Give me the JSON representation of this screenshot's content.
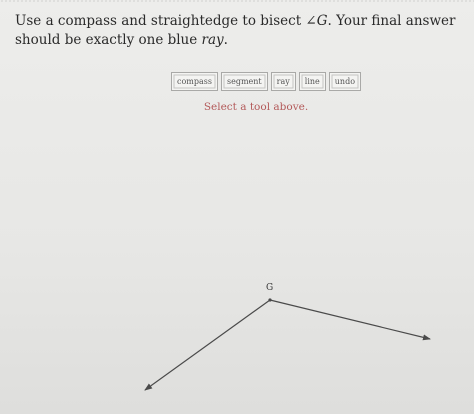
{
  "prompt": {
    "text_before": "Use a compass and straightedge to bisect ",
    "angle_symbol": "∠",
    "angle_name": "G",
    "text_middle": ". Your final answer should be exactly one blue ",
    "ray_word": "ray",
    "text_end": "."
  },
  "toolbar": {
    "buttons": [
      {
        "label": "compass"
      },
      {
        "label": "segment"
      },
      {
        "label": "ray"
      },
      {
        "label": "line"
      },
      {
        "label": "undo"
      }
    ]
  },
  "status": {
    "message": "Select a tool above."
  },
  "canvas": {
    "vertex_label": "G"
  },
  "colors": {
    "status_text": "#b35a5a",
    "ray_stroke": "#4a4a4a"
  }
}
